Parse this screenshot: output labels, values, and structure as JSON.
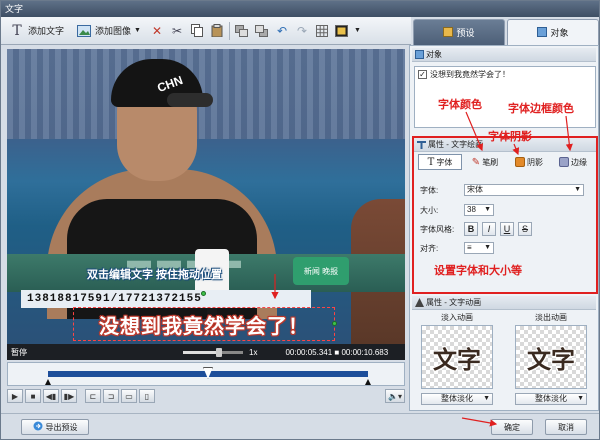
{
  "window": {
    "title": "文字"
  },
  "toolbar": {
    "add_text_label": "添加文字",
    "add_image_label": "添加图像"
  },
  "right_tabs": [
    {
      "label": "预设",
      "active": false
    },
    {
      "label": "对象",
      "active": true
    }
  ],
  "video": {
    "overlay_channel_badge": "新闻 晚报",
    "overlay_phone": "13818817591/17721372155",
    "cap_text": "CHN",
    "caption_text": "没想到我竟然学会了！",
    "hint_text": "双击编辑文字 按住拖动位置"
  },
  "player": {
    "status": "暂停",
    "speed": "1x",
    "current_time": "00:00:05.341",
    "total_time": "00:00:10.683",
    "volume_fraction": 0.6
  },
  "objects": {
    "header": "对象",
    "items": [
      {
        "label": "没想到我竟然学会了！",
        "checked": true
      }
    ]
  },
  "text_props": {
    "header": "属性 - 文字绘画",
    "tabs": [
      "字体",
      "笔刷",
      "阴影",
      "边缘"
    ],
    "font_label": "字体:",
    "font_value": "宋体",
    "size_label": "大小:",
    "size_value": "38",
    "style_label": "字体风格:",
    "style_buttons": [
      "B",
      "I",
      "U",
      "S"
    ],
    "align_label": "对齐:",
    "align_value": "≡"
  },
  "anim_props": {
    "header": "属性 - 文字动画",
    "in_label": "淡入动画",
    "out_label": "淡出动画",
    "preview_word": "文字",
    "in_effect": "整体淡化",
    "out_effect": "整体淡化"
  },
  "footer": {
    "export_label": "导出预设",
    "ok_label": "确定",
    "cancel_label": "取消"
  },
  "annotations": {
    "font_color": "字体颜色",
    "border_color": "字体边框颜色",
    "shadow": "字体阴影",
    "font_size": "设置字体和大小等"
  },
  "colors": {
    "accent_red": "#e02020",
    "timeline_blue": "#1d4e9a"
  }
}
